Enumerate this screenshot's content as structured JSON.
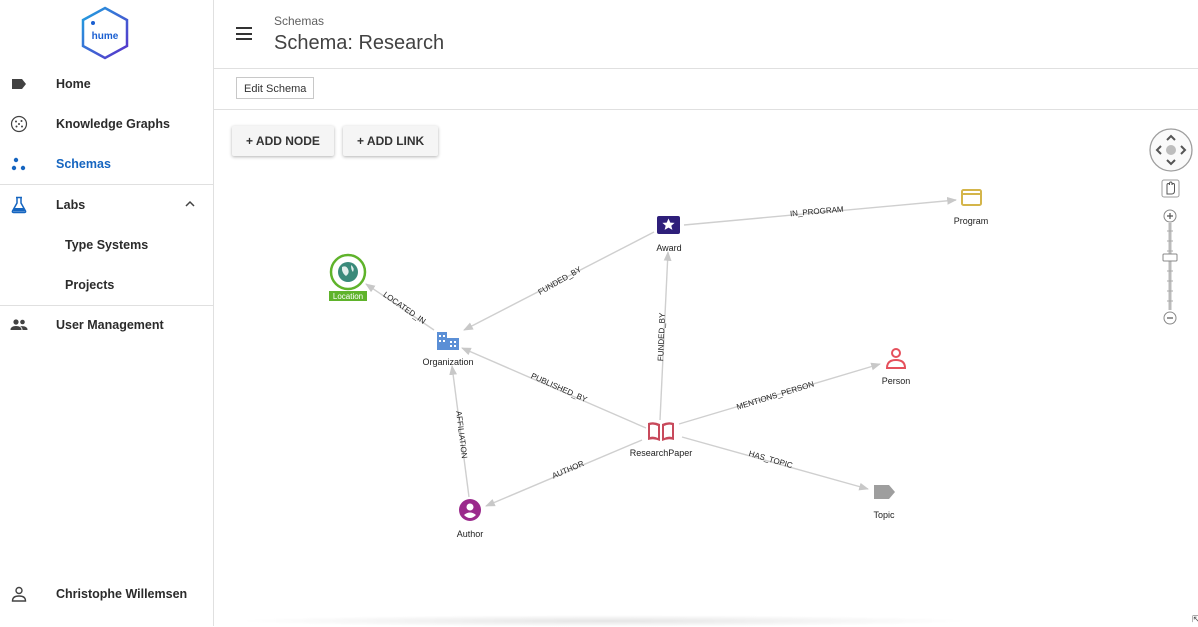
{
  "sidebar": {
    "logo_text": "hume",
    "items": [
      {
        "label": "Home",
        "icon": "label-icon"
      },
      {
        "label": "Knowledge Graphs",
        "icon": "graph-icon"
      },
      {
        "label": "Schemas",
        "icon": "schema-icon",
        "active": true
      },
      {
        "label": "Labs",
        "icon": "flask-icon"
      },
      {
        "label": "Type Systems"
      },
      {
        "label": "Projects"
      },
      {
        "label": "User Management",
        "icon": "group-icon"
      }
    ],
    "user": {
      "name": "Christophe Willemsen",
      "icon": "person-icon"
    }
  },
  "header": {
    "breadcrumb": "Schemas",
    "title": "Schema: Research"
  },
  "toolbar": {
    "edit_label": "Edit Schema"
  },
  "canvas": {
    "add_node_label": "+ ADD NODE",
    "add_link_label": "+ ADD LINK"
  },
  "graph": {
    "nodes": [
      {
        "label": "Award",
        "color": "#2e1f7a"
      },
      {
        "label": "Program",
        "color": "#d4b54a"
      },
      {
        "label": "Location",
        "color": "#5fb32b"
      },
      {
        "label": "Organization",
        "color": "#5b8fd6"
      },
      {
        "label": "Person",
        "color": "#e5505c"
      },
      {
        "label": "ResearchPaper",
        "color": "#c84a5c"
      },
      {
        "label": "Topic",
        "color": "#9e9e9e"
      },
      {
        "label": "Author",
        "color": "#9b2a8c"
      }
    ],
    "edges": [
      {
        "label": "IN_PROGRAM"
      },
      {
        "label": "FUNDED_BY"
      },
      {
        "label": "FUNDED_BY"
      },
      {
        "label": "LOCATED_IN"
      },
      {
        "label": "PUBLISHED_BY"
      },
      {
        "label": "AFFILIATION"
      },
      {
        "label": "MENTIONS_PERSON"
      },
      {
        "label": "AUTHOR"
      },
      {
        "label": "HAS_TOPIC"
      }
    ]
  },
  "colors": {
    "accent": "#1565c0",
    "logo": "#1a5fd1"
  }
}
